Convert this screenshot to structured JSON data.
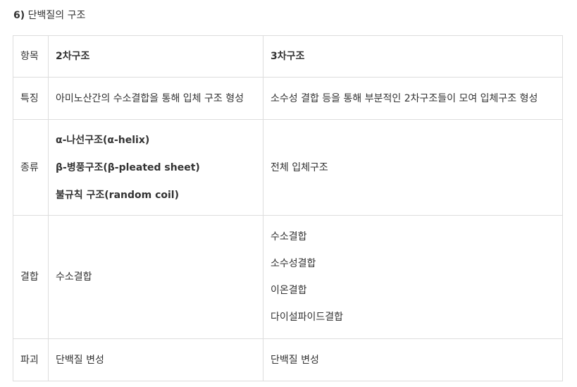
{
  "title": {
    "number": "6)",
    "text": "단백질의 구조"
  },
  "table": {
    "header": {
      "label": "항목",
      "secondary": "2차구조",
      "tertiary": "3차구조"
    },
    "feature": {
      "label": "특징",
      "secondary": "아미노산간의 수소결합을 통해 입체 구조 형성",
      "tertiary": "소수성 결합 등을 통해 부분적인 2차구조들이 모여 입체구조 형성"
    },
    "types": {
      "label": "종류",
      "secondary": [
        "α-나선구조(α-helix)",
        "β-병풍구조(β-pleated sheet)",
        "불규칙 구조(random coil)"
      ],
      "tertiary": "전체 입체구조"
    },
    "bond": {
      "label": "결합",
      "secondary": "수소결합",
      "tertiary": [
        "수소결합",
        "소수성결합",
        "이온결합",
        "다이설파이드결합"
      ]
    },
    "destruction": {
      "label": "파괴",
      "secondary": "단백질 변성",
      "tertiary": "단백질 변성"
    }
  }
}
